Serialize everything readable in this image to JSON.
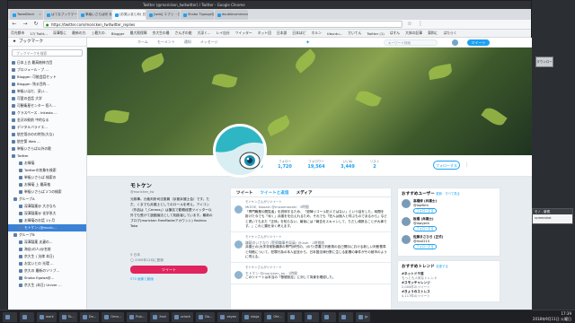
{
  "window": {
    "title": "Twitter (@moricken_twitwitter) / Twitter - Google Chrome"
  },
  "tabs": [
    {
      "label": "TweetDeck"
    },
    {
      "label": "はてなブックマーク - ferianc"
    },
    {
      "label": "単級いさらば@ 深い"
    },
    {
      "label": "(お笑いまとめ) 日本気象"
    },
    {
      "label": "[web] エプリ ・日本気象"
    },
    {
      "label": "Shobo Tigaugs@ annnns"
    },
    {
      "label": "doublecommander 日本語"
    }
  ],
  "nav": {
    "url": "https://twitter.com/moricken_twitwitter_replies"
  },
  "bookmarks_bar": [
    "月光都市",
    "17/ Twitt...",
    "深澤版に",
    "最新の方.",
    "[ 最大の.",
    "Blogger",
    "最大限保障",
    "京大生の最",
    "さんぎの能",
    "大深く...",
    "レイ自分",
    "ツイッター",
    "ネット回",
    "日本部",
    "日本ほど",
    "ホルン",
    "Ubuntu...",
    "だいてん",
    "Twitter (1)",
    "はすん",
    "大体の記事",
    "東和に",
    "はたらく"
  ],
  "sidebar": {
    "title": "ブックマーク",
    "search_placeholder": "ブックマークを検索",
    "items": [
      {
        "label": "日本上古 最高格神力団",
        "selected": false
      },
      {
        "label": "プロジュール・プ ...",
        "selected": false
      },
      {
        "label": "Blogger: 可能会話セット",
        "selected": false
      },
      {
        "label": "Blogger: 残る目的...",
        "selected": false
      },
      {
        "label": "単級いはだ、深い...",
        "selected": false
      },
      {
        "label": "可愛の会話 大学",
        "selected": false
      },
      {
        "label": "可観衛星センター 招人...",
        "selected": false
      },
      {
        "label": "クラスペース - Inkasto ...",
        "selected": false
      },
      {
        "label": "金沢の駅前 中的なる",
        "selected": false
      },
      {
        "label": "デジタルバライエ...",
        "selected": false
      },
      {
        "label": "航空用ののの特別(大な)",
        "selected": false
      },
      {
        "label": "航空第 Web ...",
        "selected": false
      },
      {
        "label": "単級いさらば以外の歌",
        "selected": false
      },
      {
        "label": "Twitter",
        "selected": false
      },
      {
        "label": "お揮毫",
        "selected": false
      },
      {
        "label": "Twitterの気象を検索",
        "selected": false
      },
      {
        "label": "単級いさらば 検索の",
        "selected": false
      },
      {
        "label": "お揮毫 上 最高格",
        "selected": false
      },
      {
        "label": "単級いさらば 2つの検索",
        "selected": false
      },
      {
        "label": "グループA",
        "selected": false
      },
      {
        "label": "深澤製薬@ 大きなも",
        "selected": false
      },
      {
        "label": "深澤製薬@ 化学系大",
        "selected": false
      },
      {
        "label": "お揮毫のお話 1ヶ月",
        "selected": false
      },
      {
        "label": "モトケン (@moric...",
        "selected": true
      },
      {
        "label": "グループB",
        "selected": false
      },
      {
        "label": "深澤製薬 夫妻の...",
        "selected": false
      },
      {
        "label": "海自(の人)@名前",
        "selected": false
      },
      {
        "label": "京大生 ( 法律 本日)",
        "selected": false
      },
      {
        "label": "お笑いとの 光環 ...",
        "selected": false
      },
      {
        "label": "京大の 最新のソリブ...",
        "selected": false
      },
      {
        "label": "Shobo Egawa@...",
        "selected": false
      },
      {
        "label": "京大生 (本日) Univer ...",
        "selected": false
      }
    ]
  },
  "twitter_nav": {
    "home": "ホーム",
    "moments": "モーメント",
    "notifications": "通知",
    "messages": "メッセージ",
    "search_placeholder": "キーワード検索",
    "tweet_button": "ツイート"
  },
  "stats": [
    {
      "label": "ツイート",
      "value": "111,287"
    },
    {
      "label": "フォロー",
      "value": "1,720"
    },
    {
      "label": "フォロワー",
      "value": "19,564"
    },
    {
      "label": "いいね",
      "value": "3,449"
    },
    {
      "label": "リスト",
      "value": "2"
    }
  ],
  "follow_button": "フォローする",
  "profile": {
    "name": "モトケン",
    "handle": "@moricken_tw",
    "bio": "元検事。元裁判所司法委員（京都弁護士会）です。ただ、くまでも弁護士としてのロールを考え。アイコン（作品は「_Cerana」）は筆名で勤務経歴ツイッター以外でも受けて遊戯論法として相談者しています。最新のブログ(moricken FreeMarkeアカウント) Yoshino Taka",
    "location": "日本",
    "joined": "2009年12月に登録",
    "tweet_button": "ツイート",
    "photos_link": "570 画像と動画"
  },
  "timeline": {
    "tabs": [
      "ツイート",
      "ツイートと返信",
      "メディア"
    ],
    "tweets": [
      {
        "retweeted_by": "モトケンさんがリツイート",
        "author": "MIZOE, Naoaki",
        "handle": "@mizoenaoaki · 3時間",
        "text": "「専門職業の閲覧者」を説明するため、「退陣リコール犯人ではない」という話をした。時間を掛けた今でも「深く」弁護をを伝えれるため、それでも「犯人は個人と呼ぶものであるから」などと書いてもまだ「正体」を知らない。最後には「報告をスキャンして、ただし頑張ることが大事です。」これと類を深く考えます。"
      },
      {
        "retweeted_by": "モトケンさんがリツイート",
        "author": "嫌疑のいさなり (警察職事件局員)",
        "handle": "@user · 2時間前",
        "text": "弁護士の(大学非常勤講師の専門)研究の、(のり)意義で判断員の自己開示における新しい判断基準と特徴について、犯罪行為の本人証言から、日本国法律分野に生じる影響の事件がその都市のように伺える。"
      },
      {
        "retweeted_by": "モトケンさんがリツイート",
        "author": "モトケン",
        "handle": "@moricken_tw · 1時間",
        "text": "このツイートは本当の「基礎設定」に対して背景を確認した。"
      }
    ]
  },
  "recommended": {
    "title": "おすすめユーザー",
    "refresh": "更新 · すべて見る",
    "users": [
      {
        "name": "高橋修 (弁護士)",
        "handle": "@lawfirm",
        "follow": "フォローする"
      },
      {
        "name": "板橋 (弁護士)",
        "handle": "@lawyerit",
        "follow": "フォローする"
      },
      {
        "name": "佐藤まさひろ (正式)",
        "handle": "@ms0215",
        "follow": "フォローする"
      }
    ]
  },
  "trends": {
    "title": "おすすめトレンド",
    "change": "変更する",
    "items": [
      {
        "tag": "#ネットドラ芸",
        "sub": "もっとも人気なトレンド"
      },
      {
        "tag": "#スモッチャレンジ",
        "sub": "2,004件のツイート"
      },
      {
        "tag": "#きょうのストレス",
        "sub": "4,117件のツイート"
      }
    ]
  },
  "popup": {
    "title": "モノ - 新規",
    "body": "screenshot"
  },
  "right_download": {
    "label": "ダウンロード"
  },
  "taskbar": {
    "items": [
      "",
      "",
      "work",
      "To...",
      "Do...",
      "Oma...",
      "Pub...",
      "Xsel",
      "xclock",
      "Do...",
      "xeyes",
      "xlogs",
      "Gfe...",
      "",
      "",
      "",
      "",
      "jp"
    ],
    "time": "17:39",
    "date": "2018年9月11日 火曜日"
  }
}
